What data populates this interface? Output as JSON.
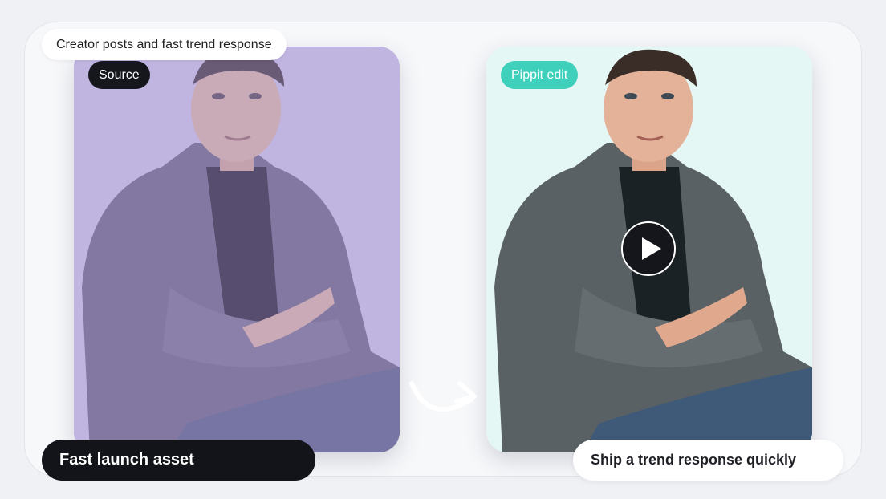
{
  "header": {
    "caption": "Creator posts and fast trend response"
  },
  "source_card": {
    "badge": "Source"
  },
  "edit_card": {
    "badge": "Pippit edit"
  },
  "footer": {
    "left_caption": "Fast launch asset",
    "right_caption": "Ship a trend response quickly"
  },
  "colors": {
    "source_bg": "#cfc7e6",
    "edit_bg": "#e6f8f5",
    "accent_teal": "#3fd0bb",
    "dark": "#12141a"
  },
  "icons": {
    "play": "play-icon",
    "arrow": "curved-arrow-icon"
  }
}
